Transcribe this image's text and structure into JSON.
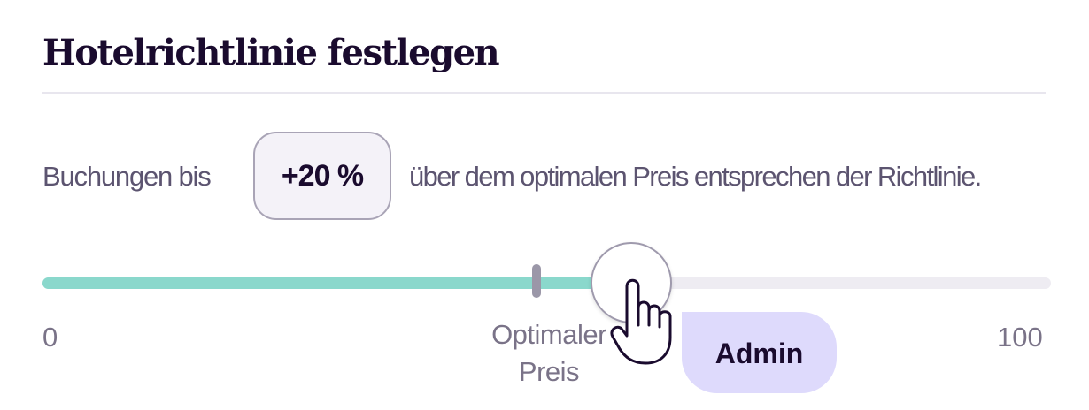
{
  "header": {
    "title": "Hotelrichtlinie festlegen"
  },
  "policy": {
    "sentence_before": "Buchungen bis",
    "value": "+20 %",
    "sentence_after": "über dem optimalen Preis entsprechen der Richtlinie."
  },
  "slider": {
    "min_label": "0",
    "max_label": "100",
    "optimal_label_line1": "Optimaler",
    "optimal_label_line2": "Preis",
    "value_percent": 59,
    "optimal_percent": 49
  },
  "cursor_tag": {
    "label": "Admin"
  },
  "colors": {
    "fill": "#8ad8cc",
    "track": "#eeecf2",
    "badge": "#dedafc",
    "title": "#1a0b2e"
  },
  "icons": {
    "cursor": "hand-pointer-icon"
  }
}
